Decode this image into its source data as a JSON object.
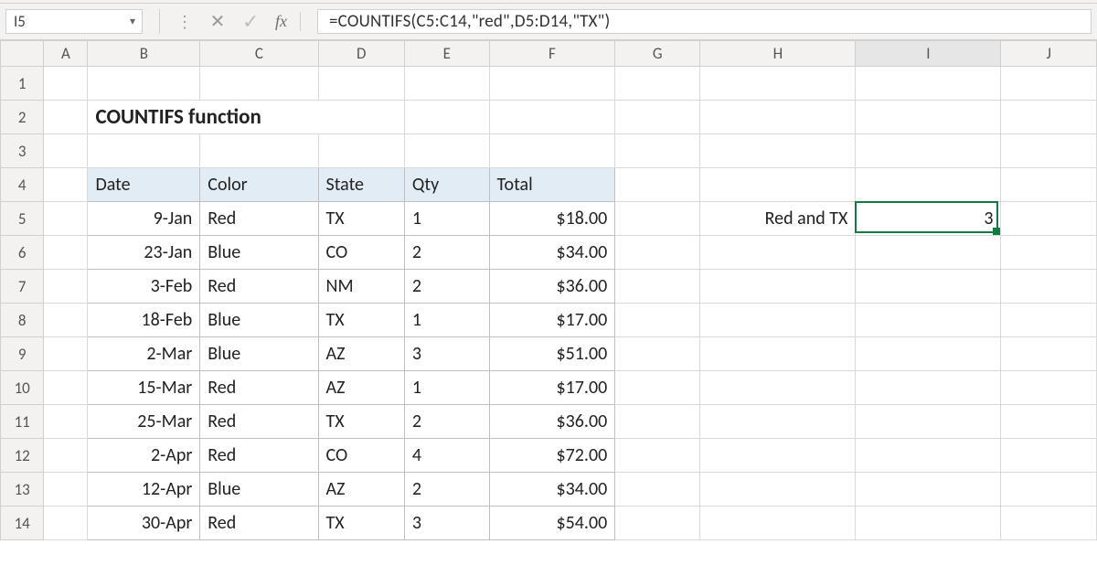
{
  "formula_bar": {
    "name_box": "I5",
    "fx_label": "fx",
    "formula": "=COUNTIFS(C5:C14,\"red\",D5:D14,\"TX\")"
  },
  "columns": [
    "A",
    "B",
    "C",
    "D",
    "E",
    "F",
    "G",
    "H",
    "I",
    "J"
  ],
  "rows": [
    "1",
    "2",
    "3",
    "4",
    "5",
    "6",
    "7",
    "8",
    "9",
    "10",
    "11",
    "12",
    "13",
    "14"
  ],
  "active": {
    "row": "5",
    "col": "I"
  },
  "title_cell": "COUNTIFS function",
  "headers": {
    "date": "Date",
    "color": "Color",
    "state": "State",
    "qty": "Qty",
    "total": "Total"
  },
  "table": [
    {
      "date": "9-Jan",
      "color": "Red",
      "state": "TX",
      "qty": "1",
      "total": "$18.00"
    },
    {
      "date": "23-Jan",
      "color": "Blue",
      "state": "CO",
      "qty": "2",
      "total": "$34.00"
    },
    {
      "date": "3-Feb",
      "color": "Red",
      "state": "NM",
      "qty": "2",
      "total": "$36.00"
    },
    {
      "date": "18-Feb",
      "color": "Blue",
      "state": "TX",
      "qty": "1",
      "total": "$17.00"
    },
    {
      "date": "2-Mar",
      "color": "Blue",
      "state": "AZ",
      "qty": "3",
      "total": "$51.00"
    },
    {
      "date": "15-Mar",
      "color": "Red",
      "state": "AZ",
      "qty": "1",
      "total": "$17.00"
    },
    {
      "date": "25-Mar",
      "color": "Red",
      "state": "TX",
      "qty": "2",
      "total": "$36.00"
    },
    {
      "date": "2-Apr",
      "color": "Red",
      "state": "CO",
      "qty": "4",
      "total": "$72.00"
    },
    {
      "date": "12-Apr",
      "color": "Blue",
      "state": "AZ",
      "qty": "2",
      "total": "$34.00"
    },
    {
      "date": "30-Apr",
      "color": "Red",
      "state": "TX",
      "qty": "3",
      "total": "$54.00"
    }
  ],
  "summary": {
    "label": "Red and TX",
    "value": "3"
  }
}
